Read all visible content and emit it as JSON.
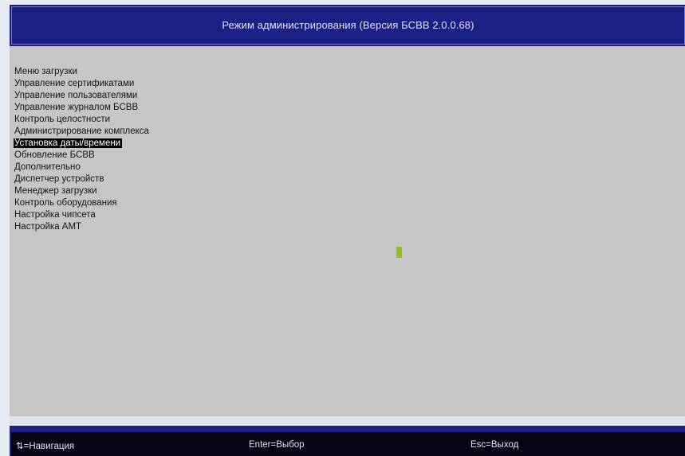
{
  "header": {
    "title": "Режим администрирования (Версия БСВВ 2.0.0.68)"
  },
  "menu": {
    "items": [
      {
        "label": "Меню загрузки"
      },
      {
        "label": "Управление сертификатами"
      },
      {
        "label": "Управление пользователями"
      },
      {
        "label": "Управление журналом БСВВ"
      },
      {
        "label": "Контроль целостности"
      },
      {
        "label": "Администрирование комплекса"
      },
      {
        "label": "Установка даты/времени",
        "selected": true
      },
      {
        "label": "Обновление БСВВ"
      },
      {
        "label": "Дополнительно"
      },
      {
        "label": "Диспетчер устройств"
      },
      {
        "label": "Менеджер загрузки"
      },
      {
        "label": "Контроль оборудования"
      },
      {
        "label": "Настройка чипсета"
      },
      {
        "label": "Настройка AMT"
      }
    ]
  },
  "footer": {
    "navigation_hint": "⇅=Навигация",
    "select_hint": "Enter=Выбор",
    "exit_hint": "Esc=Выход"
  },
  "colors": {
    "header_background": "#1c1f84",
    "content_background": "#c8c5c5",
    "selection_background": "#000000",
    "selection_text": "#ffffff",
    "cursor": "#8ec21e",
    "footer_background": "#030313"
  }
}
